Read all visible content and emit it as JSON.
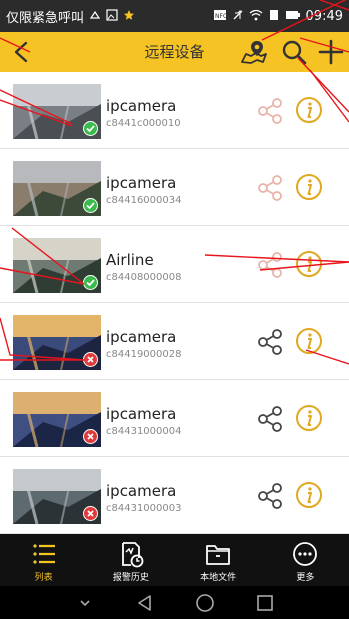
{
  "status_bar": {
    "carrier": "仅限紧急呼叫",
    "time": "09:49"
  },
  "app_bar": {
    "title": "远程设备",
    "icons": [
      "back-arrow-icon",
      "map-pin-icon",
      "search-icon",
      "plus-icon"
    ]
  },
  "devices": [
    {
      "name": "ipcamera",
      "id": "c8441c000010",
      "status": "online"
    },
    {
      "name": "ipcamera",
      "id": "c84416000034",
      "status": "online"
    },
    {
      "name": "Airline",
      "id": "c84408000008",
      "status": "online"
    },
    {
      "name": "ipcamera",
      "id": "c84419000028",
      "status": "offline"
    },
    {
      "name": "ipcamera",
      "id": "c84431000004",
      "status": "offline"
    },
    {
      "name": "ipcamera",
      "id": "c84431000003",
      "status": "offline"
    }
  ],
  "bottom_nav": [
    {
      "label": "列表",
      "icon": "list-icon",
      "active": true
    },
    {
      "label": "报警历史",
      "icon": "alarm-history-icon",
      "active": false
    },
    {
      "label": "本地文件",
      "icon": "folder-icon",
      "active": false
    },
    {
      "label": "更多",
      "icon": "more-icon",
      "active": false
    }
  ],
  "colors": {
    "accent": "#f6c324",
    "online": "#3cba4c",
    "offline": "#e03a3a",
    "nav_background": "#111111"
  }
}
